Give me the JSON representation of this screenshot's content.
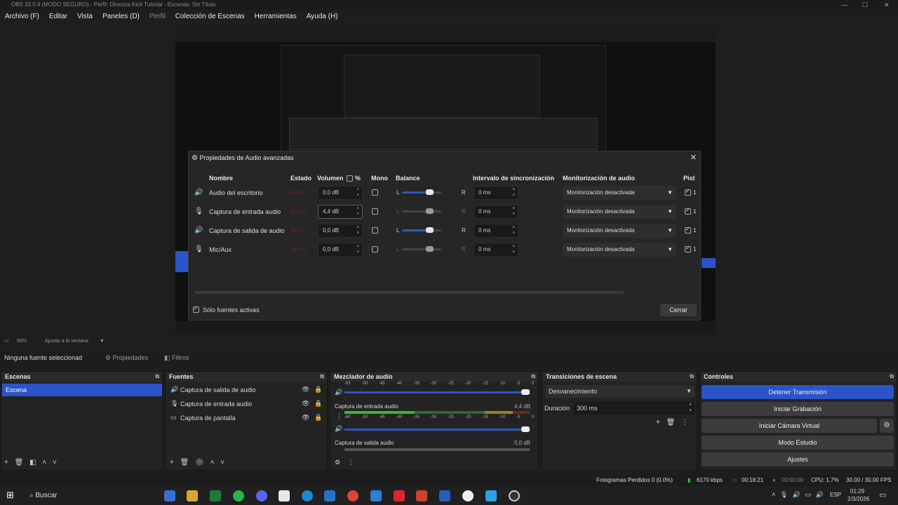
{
  "window": {
    "title": "OBS 32.0.4 (MODO SEGURO) - Perfil: Directos Kick Tutorial - Escenas: Sin Título",
    "min": "—",
    "max": "☐",
    "close": "✕"
  },
  "menu": [
    "Archivo (F)",
    "Editar",
    "Vista",
    "Paneles (D)",
    "Perfil",
    "Colección de Escenas",
    "Herramientas",
    "Ayuda (H)"
  ],
  "dialog": {
    "title": "Propiedades de Audio avanzadas",
    "headers": {
      "name": "Nombre",
      "status": "Estado",
      "volume": "Volumen",
      "percent": "%",
      "mono": "Mono",
      "balance": "Balance",
      "sync": "Intervalo de sincronización",
      "monitor": "Monitorización de audio",
      "tracks": "Pist"
    },
    "rows": [
      {
        "name": "Audio del escritorio",
        "status": "Activo",
        "volume": "0,0 dB",
        "balance_value": 0.5,
        "sync": "0 ms",
        "monitor": "Monitorización desactivada",
        "track": "1"
      },
      {
        "name": "Captura de entrada audio",
        "status": "Activo",
        "volume": "4,4 dB",
        "balance_value": 0.5,
        "sync": "0 ms",
        "monitor": "Monitorización desactivada",
        "track": "1"
      },
      {
        "name": "Captura de salida de audio",
        "status": "Activo",
        "volume": "0,0 dB",
        "balance_value": 0.5,
        "sync": "0 ms",
        "monitor": "Monitorización desactivada",
        "track": "1"
      },
      {
        "name": "Mic/Aux",
        "status": "Activo",
        "volume": "0,0 dB",
        "balance_value": 0.5,
        "sync": "0 ms",
        "monitor": "Monitorización desactivada",
        "track": "1"
      }
    ],
    "balance_l": "L",
    "balance_r": "R",
    "only_active": "Sólo fuentes activas",
    "close": "Cerrar"
  },
  "preview": {
    "zoom": "60%",
    "fit": "Ajustar a la ventana"
  },
  "source_bar": {
    "no_source": "Ninguna fuente seleccionad",
    "properties": "Propiedades",
    "filters": "Filtros"
  },
  "scenes": {
    "title": "Escenas",
    "items": [
      "Escena"
    ]
  },
  "sources": {
    "title": "Fuentes",
    "items": [
      "Captura de salida de audio",
      "Captura de entrada audio",
      "Captura de pantalla"
    ]
  },
  "mixer": {
    "title": "Mezclador de audio",
    "ticks": [
      "-60",
      "-55",
      "-50",
      "-45",
      "-40",
      "-35",
      "-30",
      "-25",
      "-20",
      "-15",
      "-10",
      "-5",
      "0"
    ],
    "channels": [
      {
        "name": "Captura de entrada audio",
        "db": "4,4 dB"
      },
      {
        "name": "Captura de salida audio",
        "db": "0,0 dB"
      }
    ]
  },
  "transitions": {
    "title": "Transiciones de escena",
    "selected": "Desvanecimiento",
    "duration_label": "Duración",
    "duration": "300 ms"
  },
  "controls": {
    "title": "Controles",
    "stop_stream": "Detener Transmisión",
    "start_rec": "Iniciar Grabación",
    "virtual_cam": "Iniciar Cámara Virtual",
    "studio": "Modo Estudio",
    "settings": "Ajustes"
  },
  "status": {
    "dropped": "Fotogramas Perdidos 0 (0.0%)",
    "bitrate": "6170 kbps",
    "stream_time": "00:18:21",
    "rec_time": "00:00:00",
    "cpu": "CPU: 1.7%",
    "fps": "30.00 / 30.00 FPS"
  },
  "taskbar": {
    "search": "Buscar",
    "time": "01:29",
    "date": "2/3/2026",
    "lang": "ESP"
  },
  "colors": {
    "accent": "#2b54c8",
    "status_red": "#7a1f1f"
  }
}
